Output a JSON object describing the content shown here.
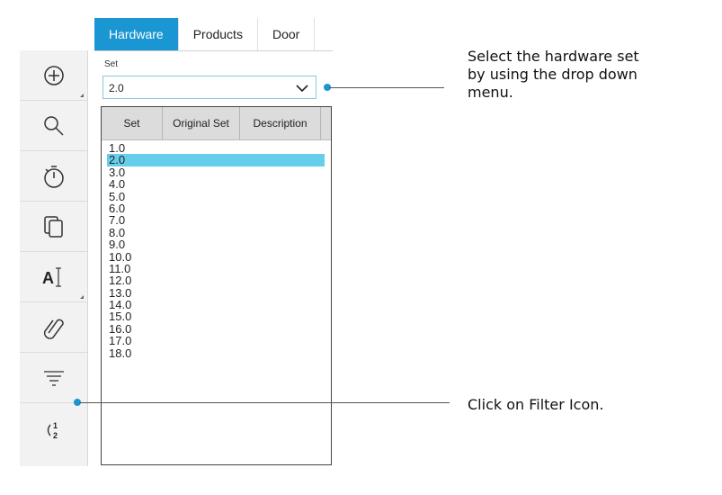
{
  "tabs": [
    "Hardware",
    "Products",
    "Door"
  ],
  "set_field": {
    "label": "Set",
    "value": "2.0"
  },
  "dropdown": {
    "columns": [
      "Set",
      "Original Set",
      "Description"
    ],
    "items": [
      "1.0",
      "2.0",
      "3.0",
      "4.0",
      "5.0",
      "6.0",
      "7.0",
      "8.0",
      "9.0",
      "10.0",
      "11.0",
      "12.0",
      "13.0",
      "14.0",
      "15.0",
      "16.0",
      "17.0",
      "18.0"
    ],
    "selected": "2.0"
  },
  "toolbar": {
    "icons": [
      "add-icon",
      "search-icon",
      "timer-icon",
      "copy-icon",
      "text-cursor-icon",
      "attachment-icon",
      "filter-icon",
      "sort-icon"
    ]
  },
  "annotations": {
    "dropdown_hint": "Select the hardware set by using the drop down menu.",
    "dropdown_hint_lines": [
      "Select the hardware set",
      "by using the drop down",
      "menu."
    ],
    "filter_hint": "Click on Filter Icon."
  },
  "colors": {
    "accent": "#1a96d2",
    "selected_row": "#66cdea"
  }
}
